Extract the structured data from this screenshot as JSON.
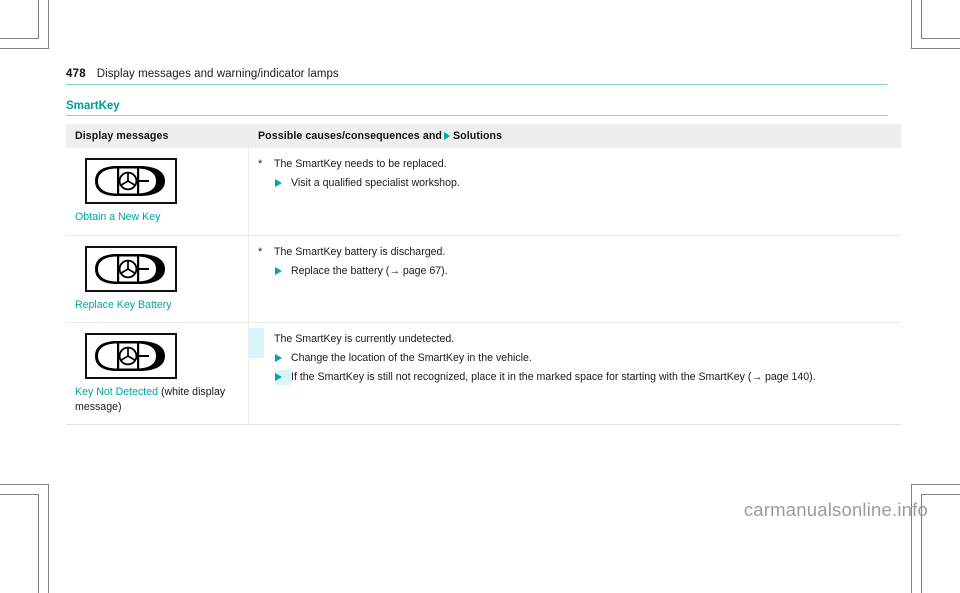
{
  "header": {
    "page_number": "478",
    "title": "Display messages and warning/indicator lamps"
  },
  "section": {
    "heading": "SmartKey"
  },
  "table": {
    "columns": {
      "display_messages": "Display messages",
      "causes_prefix": "Possible causes/consequences and",
      "causes_suffix": "Solutions"
    },
    "rows": [
      {
        "icon": "smartkey-fob-icon",
        "message": "Obtain a New Key",
        "message_note": "",
        "cause": "The SmartKey needs to be replaced.",
        "solutions": [
          {
            "text": "Visit a qualified specialist workshop.",
            "highlight": false
          }
        ]
      },
      {
        "icon": "smartkey-fob-icon",
        "message": "Replace Key Battery",
        "message_note": "",
        "cause": "The SmartKey battery is discharged.",
        "solutions": [
          {
            "text": "Replace the battery (→ page 67).",
            "highlight": false
          }
        ]
      },
      {
        "icon": "smartkey-fob-icon",
        "message": "Key Not Detected",
        "message_note": "(white display message)",
        "cause": "The SmartKey is currently undetected.",
        "solutions": [
          {
            "text": "Change the location of the SmartKey in the vehicle.",
            "highlight": false
          },
          {
            "text": "If the SmartKey is still not recognized, place it in the marked space for starting with the SmartKey (→ page 140).",
            "highlight": true
          }
        ]
      }
    ]
  },
  "watermark": {
    "text": "carmanualsonline.info"
  },
  "colors": {
    "accent_teal": "#00a5a5",
    "rule_teal": "#88d0d0",
    "header_row_bg": "#eeeeee",
    "highlight_bg": "#d8f6f6",
    "watermark_gray": "#9b9b9b"
  },
  "marks": {
    "crop_mark": "crop-registration-mark"
  }
}
